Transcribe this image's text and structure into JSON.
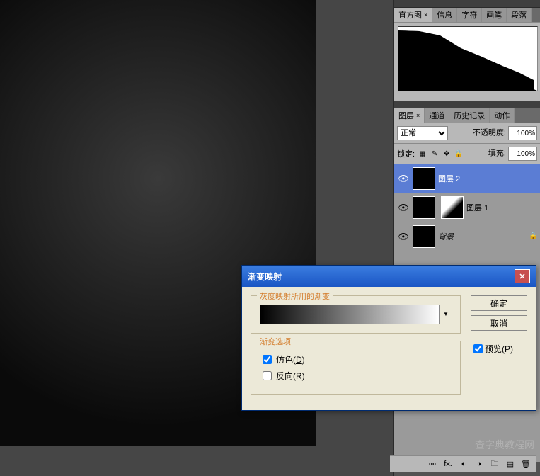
{
  "panels": {
    "histogram": {
      "tabs": [
        "直方图",
        "信息",
        "字符",
        "画笔",
        "段落"
      ],
      "active_tab": "直方图"
    },
    "layers": {
      "tabs": [
        "图层",
        "通道",
        "历史记录",
        "动作"
      ],
      "active_tab": "图层",
      "blend_mode": "正常",
      "opacity_label": "不透明度:",
      "opacity_value": "100%",
      "lock_label": "锁定:",
      "fill_label": "填充:",
      "fill_value": "100%",
      "items": [
        {
          "name": "图层 2",
          "visible": true,
          "selected": true,
          "has_mask": false
        },
        {
          "name": "图层 1",
          "visible": true,
          "selected": false,
          "has_mask": true
        },
        {
          "name": "背景",
          "visible": true,
          "selected": false,
          "locked": true
        }
      ]
    }
  },
  "dialog": {
    "title": "渐变映射",
    "group1_legend": "灰度映射所用的渐变",
    "group2_legend": "渐变选项",
    "dither_label": "仿色(",
    "dither_hotkey": "D",
    "reverse_label": "反向(",
    "reverse_hotkey": "R",
    "ok_label": "确定",
    "cancel_label": "取消",
    "preview_label": "预览(",
    "preview_hotkey": "P",
    "dither_checked": true,
    "reverse_checked": false,
    "preview_checked": true
  },
  "watermark": "查字典教程网"
}
